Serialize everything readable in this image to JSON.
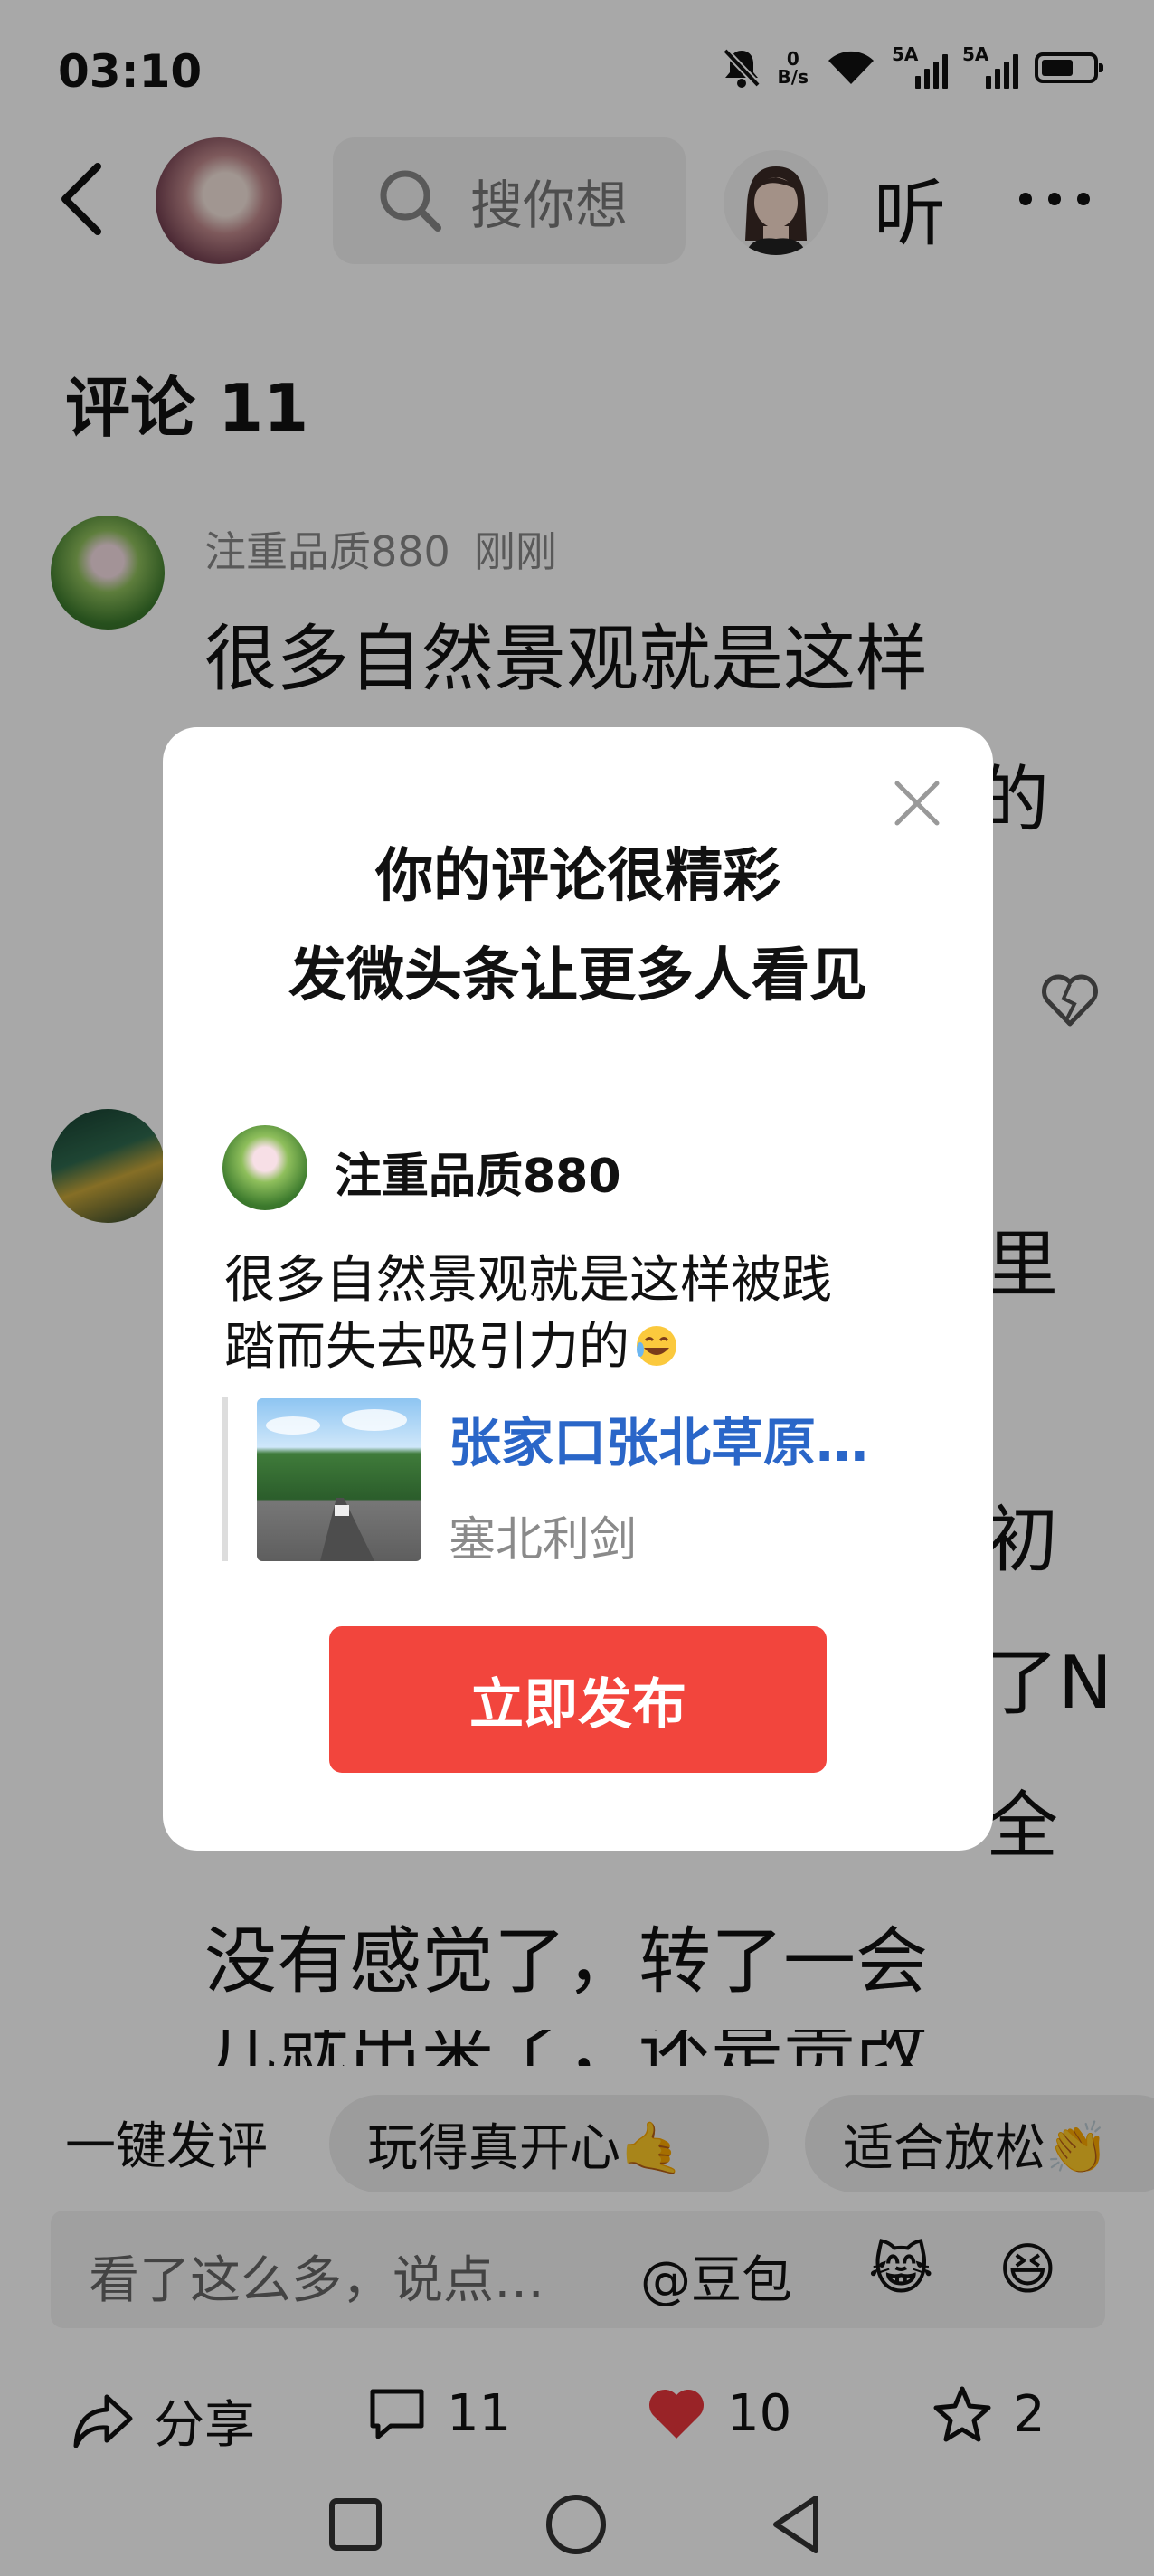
{
  "status_bar": {
    "time": "03:10",
    "net_speed_value": "0",
    "net_speed_unit": "B/s",
    "signal1_label": "5A",
    "signal2_label": "5A"
  },
  "header": {
    "search_placeholder": "搜你想",
    "listen_label": "听"
  },
  "comments": {
    "title": "评论 11",
    "items": [
      {
        "username": "注重品质880",
        "time": "刚刚",
        "text_line1": "很多自然景观就是这样",
        "text_line2_tail": "的"
      },
      {
        "visible_fragments": [
          "里",
          "初",
          "了N",
          "全"
        ],
        "text_line_a": "没有感觉了，转了一会",
        "text_line_b": "儿就出来了，还是责改"
      }
    ]
  },
  "modal": {
    "title_line1": "你的评论很精彩",
    "title_line2": "发微头条让更多人看见",
    "username": "注重品质880",
    "comment_line1": "很多自然景观就是这样被践",
    "comment_line2": "踏而失去吸引力的",
    "article_title": "张家口张北草原…",
    "article_author": "塞北利剑",
    "publish_button": "立即发布"
  },
  "quick_reply": {
    "label": "一键发评",
    "chip1": "玩得真开心🤙",
    "chip2": "适合放松👏"
  },
  "input_bar": {
    "placeholder": "看了这么多，说点…",
    "at_label": "@豆包",
    "emoji1": "😹",
    "emoji2": "😆"
  },
  "actions": {
    "share_label": "分享",
    "comment_count": "11",
    "like_count": "10",
    "favorite_count": "2"
  },
  "icons": {
    "back": "chevron-left-icon",
    "search": "search-icon",
    "more": "more-dots-icon",
    "close": "close-icon",
    "share": "share-arrow-icon",
    "comment": "comment-bubble-icon",
    "like": "heart-icon",
    "favorite": "star-icon",
    "dislike": "broken-heart-icon"
  },
  "colors": {
    "like_red": "#e8363c",
    "publish_red": "#f2453d",
    "link_blue": "#2a66c8"
  }
}
